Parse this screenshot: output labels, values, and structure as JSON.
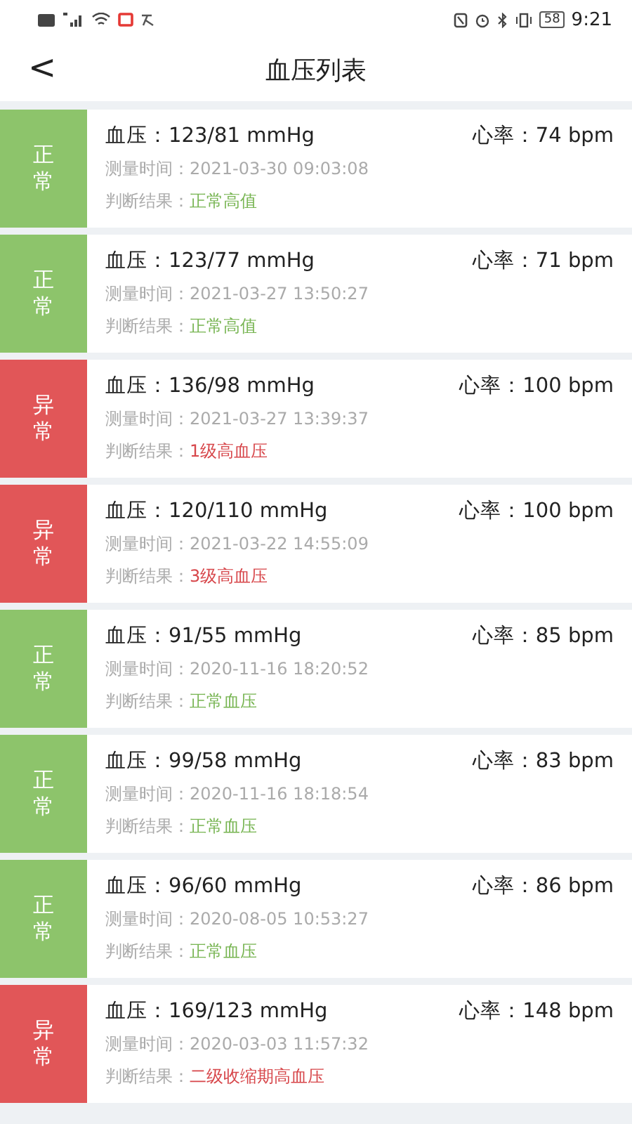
{
  "status_bar": {
    "battery": "58",
    "time": "9:21"
  },
  "header": {
    "back": "<",
    "title": "血压列表"
  },
  "records": [
    {
      "kind": "normal",
      "tag": "正常",
      "bp_label": "血压：",
      "bp": "123/81 mmHg",
      "hr_label": "心率：",
      "hr": "74 bpm",
      "time_label": "测量时间：",
      "time": "2021-03-30 09:03:08",
      "result_label": "判断结果：",
      "result": "正常高值"
    },
    {
      "kind": "normal",
      "tag": "正常",
      "bp_label": "血压：",
      "bp": "123/77 mmHg",
      "hr_label": "心率：",
      "hr": "71 bpm",
      "time_label": "测量时间：",
      "time": "2021-03-27 13:50:27",
      "result_label": "判断结果：",
      "result": "正常高值"
    },
    {
      "kind": "abnormal",
      "tag": "异常",
      "bp_label": "血压：",
      "bp": "136/98 mmHg",
      "hr_label": "心率：",
      "hr": "100 bpm",
      "time_label": "测量时间：",
      "time": "2021-03-27 13:39:37",
      "result_label": "判断结果：",
      "result": "1级高血压"
    },
    {
      "kind": "abnormal",
      "tag": "异常",
      "bp_label": "血压：",
      "bp": "120/110 mmHg",
      "hr_label": "心率：",
      "hr": "100 bpm",
      "time_label": "测量时间：",
      "time": "2021-03-22 14:55:09",
      "result_label": "判断结果：",
      "result": "3级高血压"
    },
    {
      "kind": "normal",
      "tag": "正常",
      "bp_label": "血压：",
      "bp": "91/55 mmHg",
      "hr_label": "心率：",
      "hr": "85 bpm",
      "time_label": "测量时间：",
      "time": "2020-11-16 18:20:52",
      "result_label": "判断结果：",
      "result": "正常血压"
    },
    {
      "kind": "normal",
      "tag": "正常",
      "bp_label": "血压：",
      "bp": "99/58 mmHg",
      "hr_label": "心率：",
      "hr": "83 bpm",
      "time_label": "测量时间：",
      "time": "2020-11-16 18:18:54",
      "result_label": "判断结果：",
      "result": "正常血压"
    },
    {
      "kind": "normal",
      "tag": "正常",
      "bp_label": "血压：",
      "bp": "96/60 mmHg",
      "hr_label": "心率：",
      "hr": "86 bpm",
      "time_label": "测量时间：",
      "time": "2020-08-05 10:53:27",
      "result_label": "判断结果：",
      "result": "正常血压"
    },
    {
      "kind": "abnormal",
      "tag": "异常",
      "bp_label": "血压：",
      "bp": "169/123 mmHg",
      "hr_label": "心率：",
      "hr": "148 bpm",
      "time_label": "测量时间：",
      "time": "2020-03-03 11:57:32",
      "result_label": "判断结果：",
      "result": "二级收缩期高血压"
    }
  ]
}
